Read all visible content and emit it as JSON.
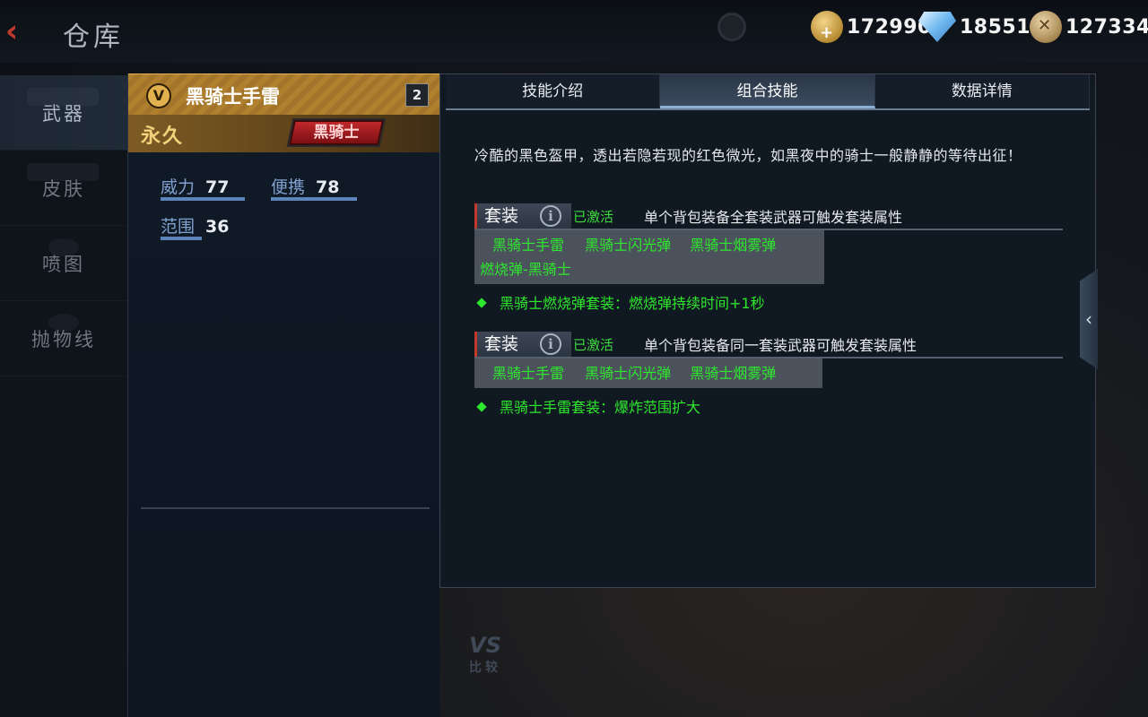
{
  "header": {
    "back_icon": "back-chevron-icon",
    "title": "仓库",
    "currencies": [
      {
        "icon": "gold-coin-icon",
        "value": "172990"
      },
      {
        "icon": "diamond-icon",
        "value": "18551"
      },
      {
        "icon": "crossed-swords-coin-icon",
        "value": "127334"
      }
    ]
  },
  "sidebar": {
    "items": [
      {
        "label": "武器",
        "active": true
      },
      {
        "label": "皮肤",
        "active": false
      },
      {
        "label": "喷图",
        "active": false
      },
      {
        "label": "抛物线",
        "active": false
      }
    ]
  },
  "item": {
    "badge": "V",
    "name": "黑骑士手雷",
    "count": "2",
    "duration": "永久",
    "tag": "黑骑士",
    "stats": [
      {
        "label": "威力",
        "value": "77"
      },
      {
        "label": "便携",
        "value": "78"
      },
      {
        "label": "范围",
        "value": "36"
      }
    ]
  },
  "compare": {
    "vs": "VS",
    "label": "比较"
  },
  "tabs": [
    {
      "label": "技能介绍",
      "active": false
    },
    {
      "label": "组合技能",
      "active": true
    },
    {
      "label": "数据详情",
      "active": false
    }
  ],
  "skill": {
    "description": "冷酷的黑色盔甲，透出若隐若现的红色微光，如黑夜中的骑士一般静静的等待出征！",
    "sets": [
      {
        "badge": "套装",
        "status": "已激活",
        "condition": "单个背包装备全套装武器可触发套装属性",
        "items": [
          "黑骑士手雷",
          "黑骑士闪光弹",
          "黑骑士烟雾弹",
          "燃烧弹-黑骑士"
        ],
        "bonus": "黑骑士燃烧弹套装：燃烧弹持续时间+1秒"
      },
      {
        "badge": "套装",
        "status": "已激活",
        "condition": "单个背包装备同一套装武器可触发套装属性",
        "items": [
          "黑骑士手雷",
          "黑骑士闪光弹",
          "黑骑士烟雾弹"
        ],
        "bonus": "黑骑士手雷套装：爆炸范围扩大"
      }
    ]
  },
  "colors": {
    "active_green": "#2ee82e",
    "gold_header": "#b0802f",
    "stat_label": "#7fa1cf"
  }
}
